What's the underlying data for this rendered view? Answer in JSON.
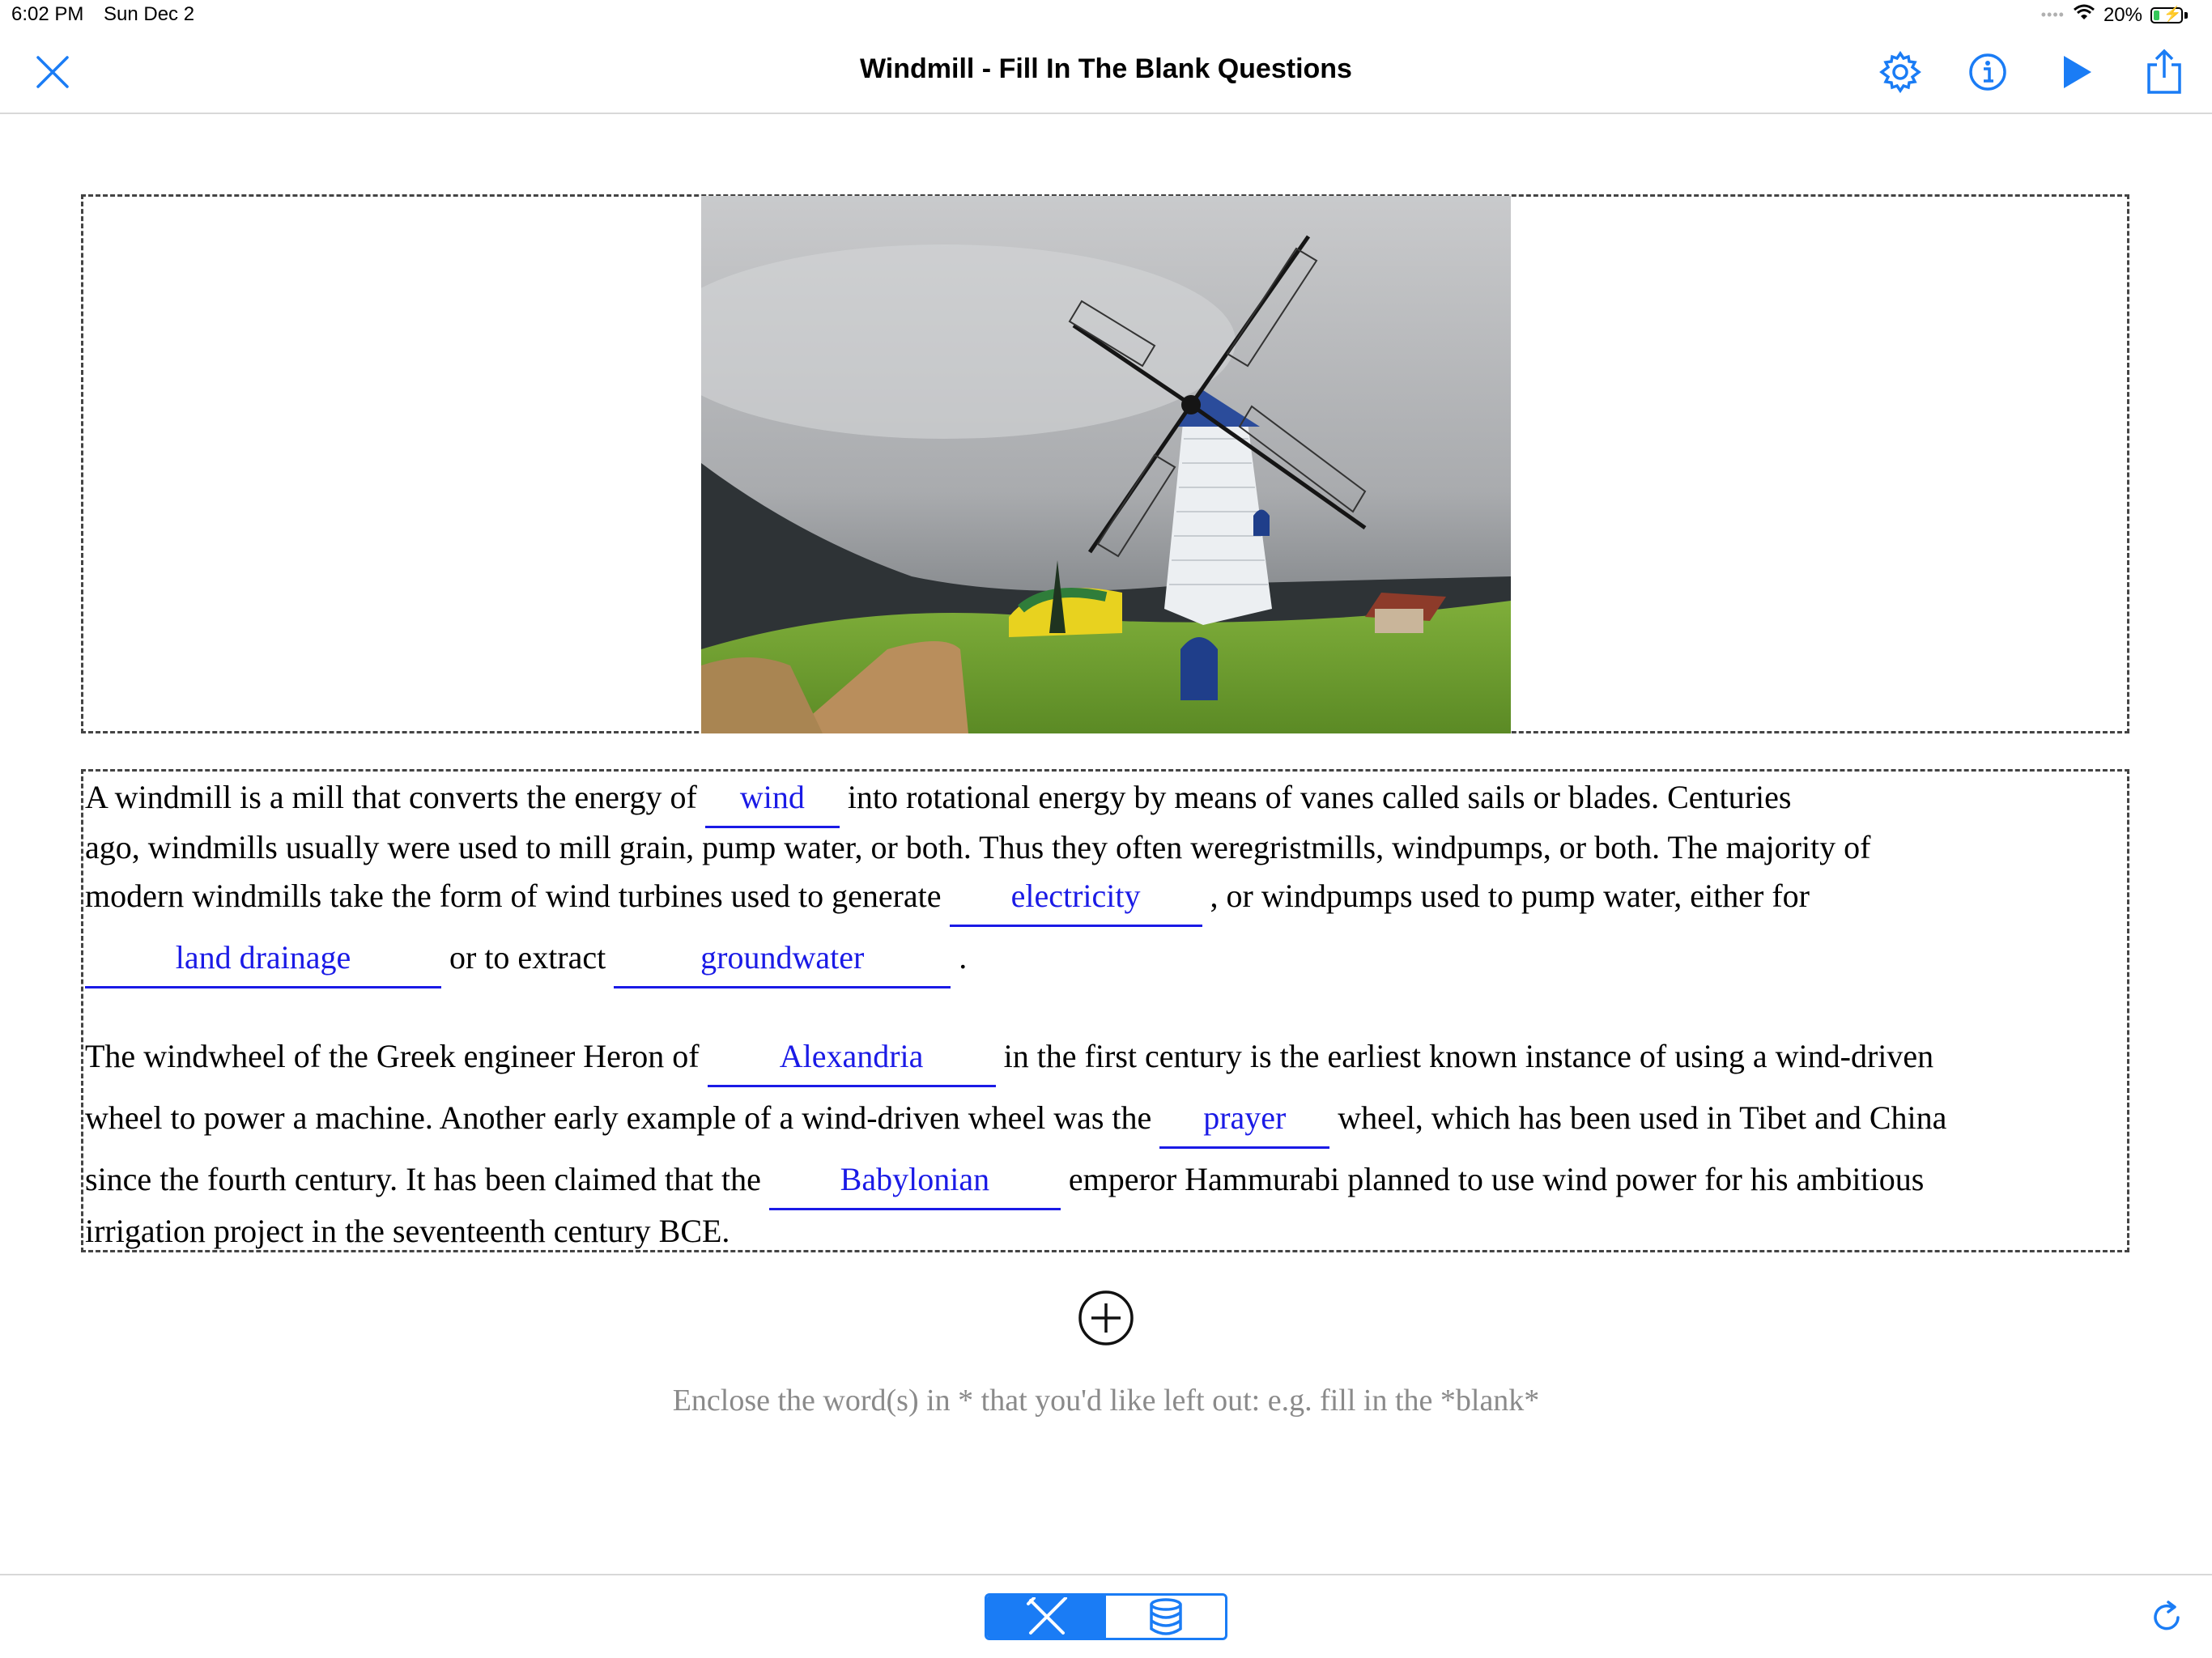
{
  "status_bar": {
    "time": "6:02 PM",
    "date": "Sun Dec 2",
    "battery": "20%"
  },
  "nav": {
    "title": "Windmill - Fill In The Blank Questions",
    "icons": [
      "close-icon",
      "gear-icon",
      "info-icon",
      "play-icon",
      "share-icon"
    ]
  },
  "image": {
    "description_icon": "windmill-photo"
  },
  "passage": {
    "p1_l1_a": "A windmill is a mill that converts the energy of",
    "p1_l1_blank": "wind",
    "p1_l1_b": "into rotational energy by means of vanes called sails or blades. Centuries",
    "p1_l2": "ago, windmills usually were used to mill grain, pump water, or both. Thus they often weregristmills, windpumps, or both. The majority of",
    "p1_l3_a": "modern windmills take the form of wind turbines used to generate",
    "p1_l3_blank": "electricity",
    "p1_l3_b": ", or windpumps used to pump water, either for",
    "p1_l4_blank1": "land drainage",
    "p1_l4_a": "or to extract",
    "p1_l4_blank2": "groundwater",
    "p1_l4_b": ".",
    "p2_l1_a": "The windwheel of the Greek engineer Heron of",
    "p2_l1_blank": "Alexandria",
    "p2_l1_b": "in the first century is the earliest known instance of using a wind-driven",
    "p2_l2_a": "wheel to power a machine. Another early example of a wind-driven wheel was the",
    "p2_l2_blank": "prayer",
    "p2_l2_b": "wheel, which has been used in Tibet and China",
    "p2_l3_a": "since the fourth century. It has been claimed that the",
    "p2_l3_blank": "Babylonian",
    "p2_l3_b": "emperor Hammurabi planned to use wind power for his ambitious",
    "p2_l4": "irrigation project in the seventeenth century BCE."
  },
  "hint": "Enclose the word(s) in * that you'd like left out: e.g. fill in the *blank*",
  "toolbar": {
    "segments": [
      "tools-icon",
      "database-icon"
    ],
    "active_segment": "tools-icon",
    "refresh_icon": "refresh-icon"
  },
  "colors": {
    "accent": "#1a7cf5",
    "blank_text": "#1a1ae6",
    "hint_text": "#8a8a8a"
  }
}
